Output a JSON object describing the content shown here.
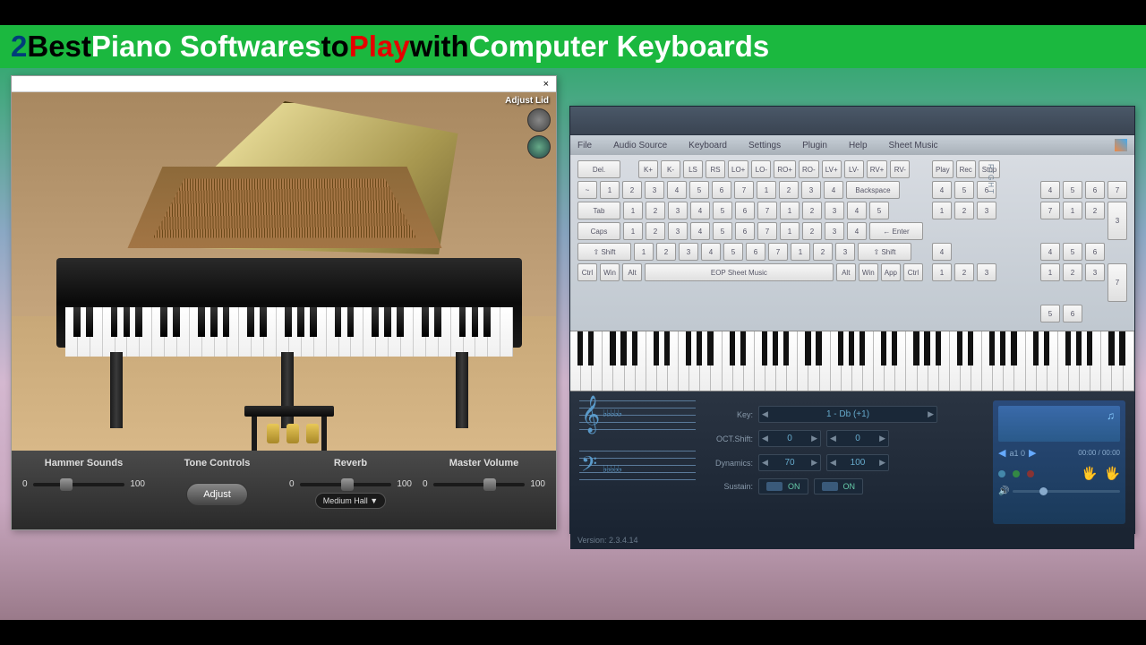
{
  "title": {
    "num": "2 ",
    "best": "Best ",
    "piano": "Piano Softwares ",
    "to": "to ",
    "play": "Play ",
    "with": "with ",
    "kb": "Computer Keyboards"
  },
  "app1": {
    "adjust_lid": "Adjust Lid",
    "close": "×",
    "controls": {
      "hammer": "Hammer Sounds",
      "tone": "Tone Controls",
      "adjust": "Adjust",
      "reverb": "Reverb",
      "reverb_val": "Medium Hall ▼",
      "master": "Master Volume",
      "min": "0",
      "max": "100"
    }
  },
  "app2": {
    "menu": [
      "File",
      "Audio Source",
      "Keyboard",
      "Settings",
      "Plugin",
      "Help",
      "Sheet Music"
    ],
    "row1_left": [
      "Del."
    ],
    "row1_mid": [
      "K+",
      "K-",
      "LS",
      "RS",
      "LO+",
      "LO-",
      "RO+",
      "RO-",
      "LV+",
      "LV-",
      "RV+",
      "RV-"
    ],
    "row1_right": [
      "Play",
      "Rec",
      "Stop"
    ],
    "row2_left": [
      "~",
      "1",
      "2",
      "3",
      "4",
      "5",
      "6",
      "7",
      "1",
      "2",
      "3",
      "4"
    ],
    "row2_bksp": "Backspace",
    "row2_right": [
      "4",
      "5",
      "6"
    ],
    "row2_right2": [
      "4",
      "5",
      "6",
      "7"
    ],
    "row3_tab": "Tab",
    "row3_mid": [
      "1",
      "2",
      "3",
      "4",
      "5",
      "6",
      "7",
      "1",
      "2",
      "3",
      "4",
      "5"
    ],
    "row3_right": [
      "1",
      "2",
      "3"
    ],
    "row3_right2a": [
      "7",
      "1",
      "2"
    ],
    "row3_right2b": "3",
    "row4_caps": "Caps",
    "row4_mid": [
      "1",
      "2",
      "3",
      "4",
      "5",
      "6",
      "7",
      "1",
      "2",
      "3",
      "4"
    ],
    "row4_enter": "← Enter",
    "row4_right2": [
      "4",
      "5",
      "6"
    ],
    "row5_shift": "⇧ Shift",
    "row5_mid": [
      "1",
      "2",
      "3",
      "4",
      "5",
      "6",
      "7",
      "1",
      "2",
      "3"
    ],
    "row5_shift2": "⇧ Shift",
    "row5_right": [
      "4"
    ],
    "row5_right2": [
      "1",
      "2",
      "3"
    ],
    "row5_right2b": "7",
    "row6": [
      "Ctrl",
      "Win",
      "Alt"
    ],
    "row6_space": "EOP Sheet Music",
    "row6_end": [
      "Alt",
      "Win",
      "App",
      "Ctrl"
    ],
    "row6_right": [
      "1",
      "2",
      "3"
    ],
    "row6_right2": [
      "5",
      "6"
    ],
    "settings": {
      "key_label": "Key:",
      "key_val": "1 - Db (+1)",
      "oct_label": "OCT.Shift:",
      "oct_val1": "0",
      "oct_val2": "0",
      "dyn_label": "Dynamics:",
      "dyn_val1": "70",
      "dyn_val2": "100",
      "sus_label": "Sustain:",
      "on": "ON",
      "right_label": "RIGHT"
    },
    "player": {
      "track": "a1 0",
      "time": "00:00 / 00:00"
    },
    "version": "Version: 2.3.4.14"
  }
}
